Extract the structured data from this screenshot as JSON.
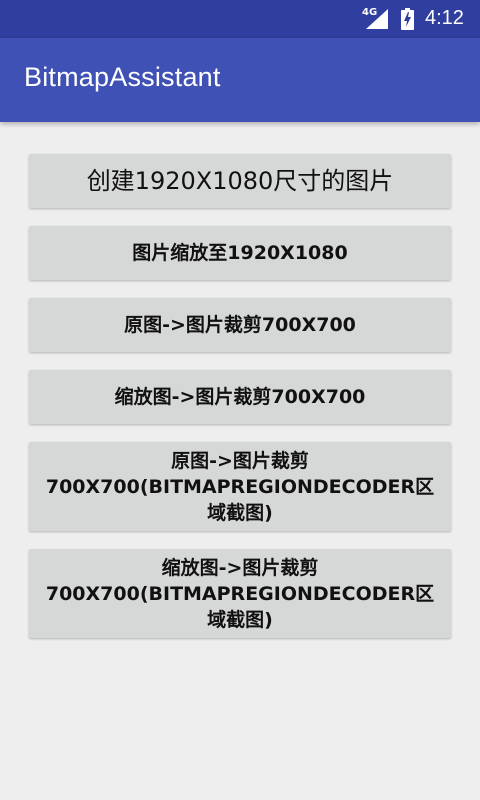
{
  "status_bar": {
    "network": "4G",
    "time": "4:12"
  },
  "app_bar": {
    "title": "BitmapAssistant"
  },
  "buttons": [
    {
      "label": "创建1920X1080尺寸的图片"
    },
    {
      "label": "图片缩放至1920X1080"
    },
    {
      "label": "原图->图片裁剪700X700"
    },
    {
      "label": "缩放图->图片裁剪700X700"
    },
    {
      "label": "原图->图片裁剪700X700(BITMAPREGIONDECODER区域截图)"
    },
    {
      "label": "缩放图->图片裁剪700X700(BITMAPREGIONDECODER区域截图)"
    }
  ],
  "colors": {
    "primary": "#3f51b5",
    "primary_dark": "#303f9f",
    "button": "#d6d7d7",
    "background": "#eeeeee"
  }
}
